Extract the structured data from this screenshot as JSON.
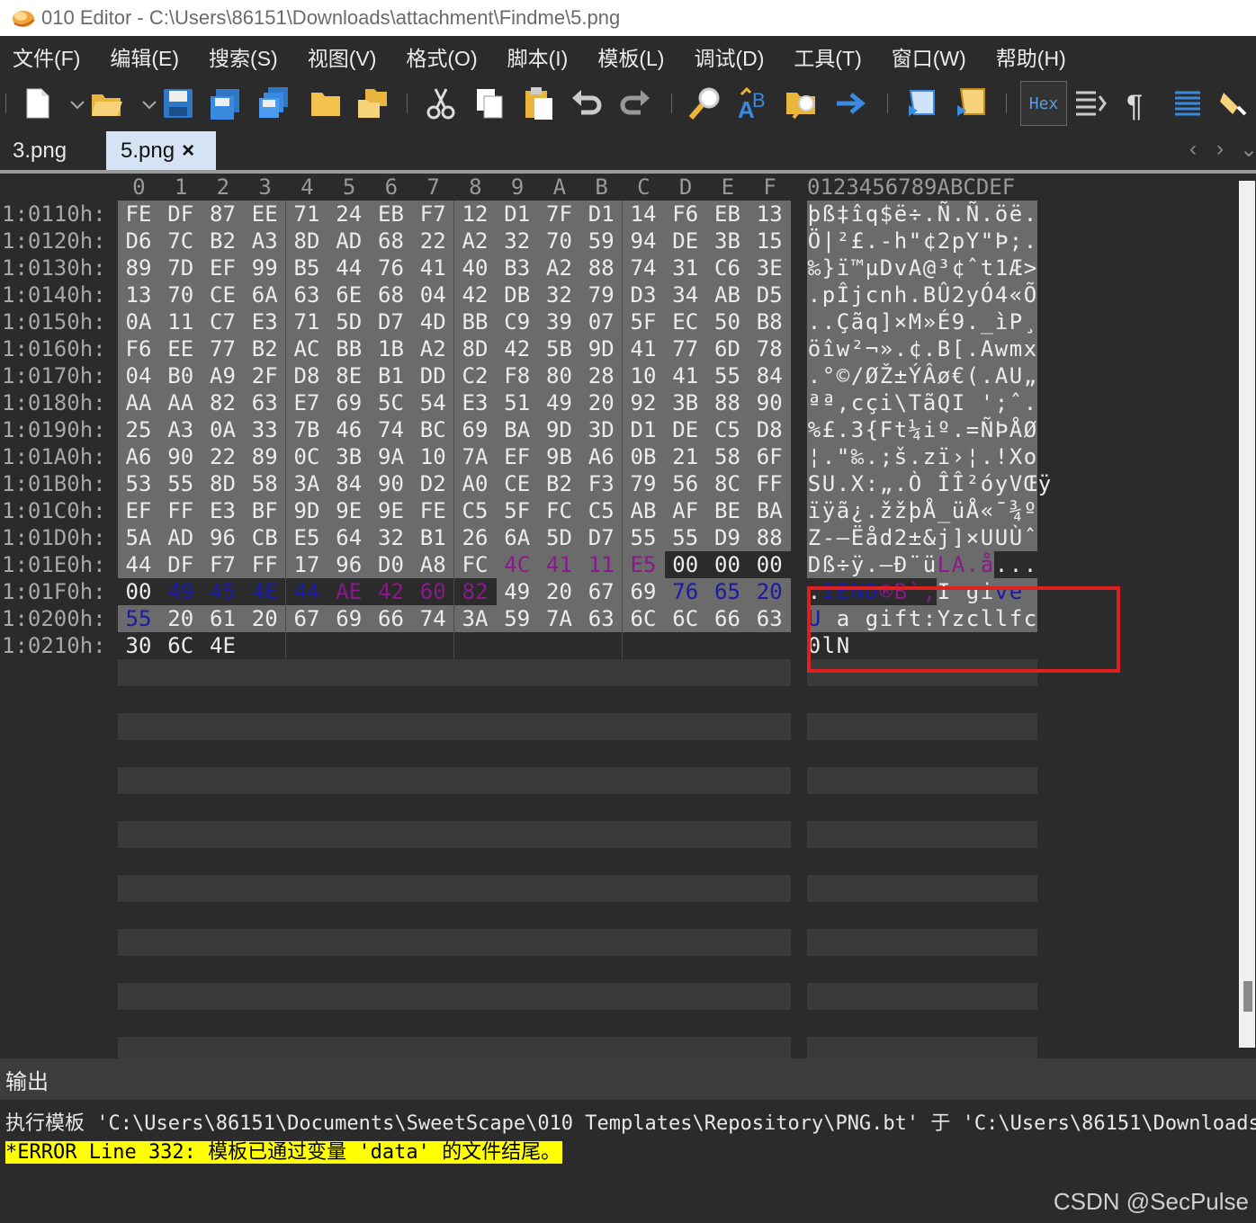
{
  "window": {
    "app_title": "010 Editor - C:\\Users\\86151\\Downloads\\attachment\\Findme\\5.png"
  },
  "menu": [
    "文件(F)",
    "编辑(E)",
    "搜索(S)",
    "视图(V)",
    "格式(O)",
    "脚本(I)",
    "模板(L)",
    "调试(D)",
    "工具(T)",
    "窗口(W)",
    "帮助(H)"
  ],
  "toolbar": {
    "hex_label": "Hex",
    "icons": [
      "new-file-icon",
      "open-folder-icon",
      "save-icon",
      "save-as-icon",
      "save-all-icon",
      "folder-icon",
      "open-multiple-icon",
      "cut-icon",
      "copy-icon",
      "paste-icon",
      "undo-icon",
      "redo-icon",
      "find-icon",
      "replace-icon",
      "find-in-files-icon",
      "goto-icon",
      "run-script-icon",
      "run-template-icon",
      "hex-mode-icon",
      "columns-icon",
      "paragraph-icon",
      "list-icon",
      "highlight-icon"
    ]
  },
  "tabs": [
    {
      "label": "3.png",
      "active": false
    },
    {
      "label": "5.png",
      "active": true,
      "close": "×"
    }
  ],
  "tab_nav": {
    "prev": "‹",
    "next": "›",
    "menu": "⌄"
  },
  "hex": {
    "column_headers": [
      "0",
      "1",
      "2",
      "3",
      "4",
      "5",
      "6",
      "7",
      "8",
      "9",
      "A",
      "B",
      "C",
      "D",
      "E",
      "F"
    ],
    "ascii_header": "0123456789ABCDEF",
    "rows": [
      {
        "addr": "1:0110h:",
        "bytes": [
          "FE",
          "DF",
          "87",
          "EE",
          "71",
          "24",
          "EB",
          "F7",
          "12",
          "D1",
          "7F",
          "D1",
          "14",
          "F6",
          "EB",
          "13"
        ],
        "ascii": "þß‡îq$ë÷.Ñ.Ñ.öë."
      },
      {
        "addr": "1:0120h:",
        "bytes": [
          "D6",
          "7C",
          "B2",
          "A3",
          "8D",
          "AD",
          "68",
          "22",
          "A2",
          "32",
          "70",
          "59",
          "94",
          "DE",
          "3B",
          "15"
        ],
        "ascii": "Ö|²£.-h\"¢2pY\"Þ;."
      },
      {
        "addr": "1:0130h:",
        "bytes": [
          "89",
          "7D",
          "EF",
          "99",
          "B5",
          "44",
          "76",
          "41",
          "40",
          "B3",
          "A2",
          "88",
          "74",
          "31",
          "C6",
          "3E"
        ],
        "ascii": "‰}ï™µDvA@³¢ˆt1Æ>"
      },
      {
        "addr": "1:0140h:",
        "bytes": [
          "13",
          "70",
          "CE",
          "6A",
          "63",
          "6E",
          "68",
          "04",
          "42",
          "DB",
          "32",
          "79",
          "D3",
          "34",
          "AB",
          "D5"
        ],
        "ascii": ".pÎjcnh.BÛ2yÓ4«Õ"
      },
      {
        "addr": "1:0150h:",
        "bytes": [
          "0A",
          "11",
          "C7",
          "E3",
          "71",
          "5D",
          "D7",
          "4D",
          "BB",
          "C9",
          "39",
          "07",
          "5F",
          "EC",
          "50",
          "B8"
        ],
        "ascii": "..Çãq]×M»É9._ìP¸"
      },
      {
        "addr": "1:0160h:",
        "bytes": [
          "F6",
          "EE",
          "77",
          "B2",
          "AC",
          "BB",
          "1B",
          "A2",
          "8D",
          "42",
          "5B",
          "9D",
          "41",
          "77",
          "6D",
          "78"
        ],
        "ascii": "öîw²¬».¢.B[.Awmx"
      },
      {
        "addr": "1:0170h:",
        "bytes": [
          "04",
          "B0",
          "A9",
          "2F",
          "D8",
          "8E",
          "B1",
          "DD",
          "C2",
          "F8",
          "80",
          "28",
          "10",
          "41",
          "55",
          "84"
        ],
        "ascii": ".°©/ØŽ±ÝÂø€(.AU„"
      },
      {
        "addr": "1:0180h:",
        "bytes": [
          "AA",
          "AA",
          "82",
          "63",
          "E7",
          "69",
          "5C",
          "54",
          "E3",
          "51",
          "49",
          "20",
          "92",
          "3B",
          "88",
          "90"
        ],
        "ascii": "ªª‚cçi\\TãQI ';ˆ."
      },
      {
        "addr": "1:0190h:",
        "bytes": [
          "25",
          "A3",
          "0A",
          "33",
          "7B",
          "46",
          "74",
          "BC",
          "69",
          "BA",
          "9D",
          "3D",
          "D1",
          "DE",
          "C5",
          "D8"
        ],
        "ascii": "%£.3{Ft¼iº.=ÑÞÅØ"
      },
      {
        "addr": "1:01A0h:",
        "bytes": [
          "A6",
          "90",
          "22",
          "89",
          "0C",
          "3B",
          "9A",
          "10",
          "7A",
          "EF",
          "9B",
          "A6",
          "0B",
          "21",
          "58",
          "6F"
        ],
        "ascii": "¦.\"‰.;š.zï›¦.!Xo"
      },
      {
        "addr": "1:01B0h:",
        "bytes": [
          "53",
          "55",
          "8D",
          "58",
          "3A",
          "84",
          "90",
          "D2",
          "A0",
          "CE",
          "B2",
          "F3",
          "79",
          "56",
          "8C",
          "FF"
        ],
        "ascii": "SU.X:„.Ò ÎÎ²óyVŒÿ"
      },
      {
        "addr": "1:01C0h:",
        "bytes": [
          "EF",
          "FF",
          "E3",
          "BF",
          "9D",
          "9E",
          "9E",
          "FE",
          "C5",
          "5F",
          "FC",
          "C5",
          "AB",
          "AF",
          "BE",
          "BA"
        ],
        "ascii": "ïÿã¿.žžþÅ_üÅ«¯¾º"
      },
      {
        "addr": "1:01D0h:",
        "bytes": [
          "5A",
          "AD",
          "96",
          "CB",
          "E5",
          "64",
          "32",
          "B1",
          "26",
          "6A",
          "5D",
          "D7",
          "55",
          "55",
          "D9",
          "88"
        ],
        "ascii": "Z-–Ëåd2±&j]×UUÙˆ"
      },
      {
        "addr": "1:01E0h:",
        "bytes": [
          "44",
          "DF",
          "F7",
          "FF",
          "17",
          "96",
          "D0",
          "A8",
          "FC",
          "4C",
          "41",
          "11",
          "E5",
          "00",
          "00",
          "00"
        ],
        "ascii": "Dß÷ÿ.–Ð¨üLA.å..."
      },
      {
        "addr": "1:01F0h:",
        "bytes": [
          "00",
          "49",
          "45",
          "4E",
          "44",
          "AE",
          "42",
          "60",
          "82",
          "49",
          "20",
          "67",
          "69",
          "76",
          "65",
          "20"
        ],
        "ascii": ".IEND®B`‚I give "
      },
      {
        "addr": "1:0200h:",
        "bytes": [
          "55",
          "20",
          "61",
          "20",
          "67",
          "69",
          "66",
          "74",
          "3A",
          "59",
          "7A",
          "63",
          "6C",
          "6C",
          "66",
          "63"
        ],
        "ascii": "U a gift:Yzcllfc"
      },
      {
        "addr": "1:0210h:",
        "bytes": [
          "30",
          "6C",
          "4E"
        ],
        "ascii": "0lN"
      }
    ],
    "purple_bytes": [
      [
        13,
        9
      ],
      [
        13,
        10
      ],
      [
        13,
        11
      ],
      [
        13,
        12
      ],
      [
        14,
        5
      ],
      [
        14,
        6
      ],
      [
        14,
        7
      ],
      [
        14,
        8
      ]
    ],
    "blue_bytes": [
      [
        14,
        1
      ],
      [
        14,
        2
      ],
      [
        14,
        3
      ],
      [
        14,
        4
      ],
      [
        14,
        13
      ],
      [
        14,
        14
      ],
      [
        14,
        15
      ],
      [
        15,
        0
      ]
    ],
    "colors": {
      "purple": "#8a1a8a",
      "blue": "#1a1aa8",
      "selected_bg": "#6b6b6b",
      "highlight_box": "#e02020"
    }
  },
  "output": {
    "header": "输出",
    "line1": "执行模板 'C:\\Users\\86151\\Documents\\SweetScape\\010 Templates\\Repository\\PNG.bt' 于 'C:\\Users\\86151\\Downloads",
    "error": "*ERROR Line 332: 模板已通过变量 'data' 的文件结尾。"
  },
  "watermark": "CSDN @SecPulse"
}
